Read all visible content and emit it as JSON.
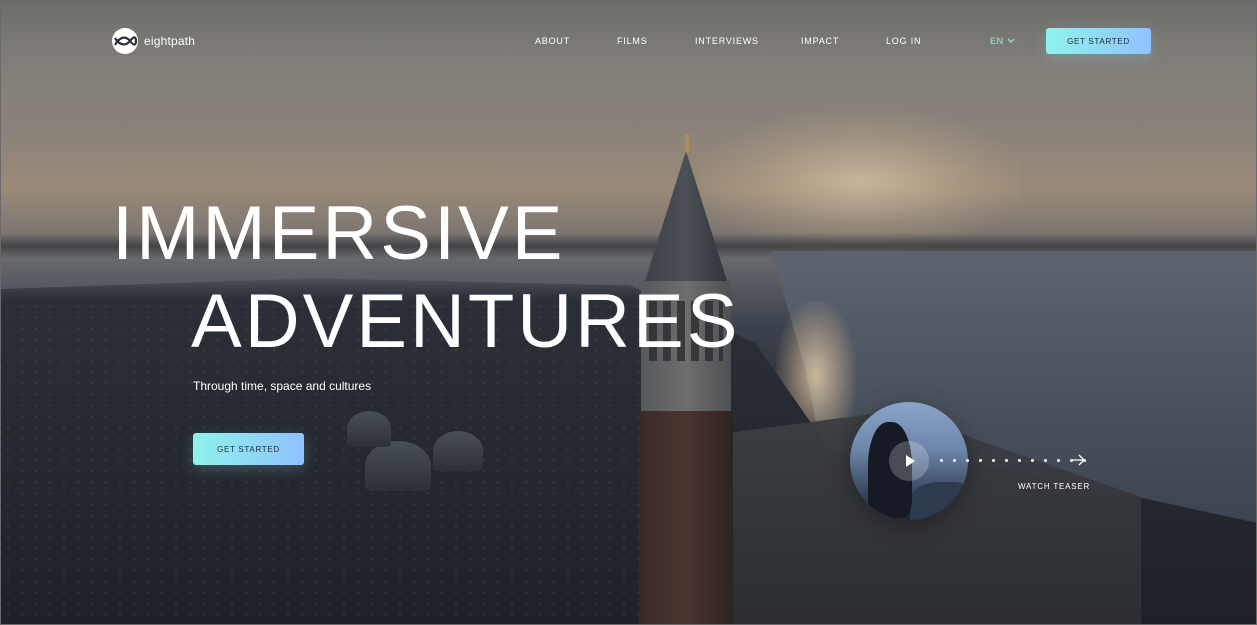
{
  "brand": {
    "name": "eightpath",
    "logo_icon": "eightpath-logo-icon"
  },
  "nav": {
    "items": [
      {
        "label": "ABOUT"
      },
      {
        "label": "FILMS"
      },
      {
        "label": "INTERVIEWS"
      },
      {
        "label": "IMPACT"
      },
      {
        "label": "LOG IN"
      }
    ],
    "language": {
      "label": "EN",
      "icon": "chevron-down-icon"
    },
    "cta_label": "GET STARTED"
  },
  "hero": {
    "title_line1": "IMMERSIVE",
    "title_line2": "ADVENTURES",
    "subtitle": "Through time, space and cultures",
    "cta_label": "GET STARTED"
  },
  "teaser": {
    "label": "WATCH TEASER",
    "play_icon": "play-icon",
    "arrow_icon": "arrow-right-icon"
  },
  "colors": {
    "accent_start": "#8ff3ea",
    "accent_end": "#8fc2ff",
    "lang_color": "#8ff0ea",
    "text": "#ffffff"
  }
}
